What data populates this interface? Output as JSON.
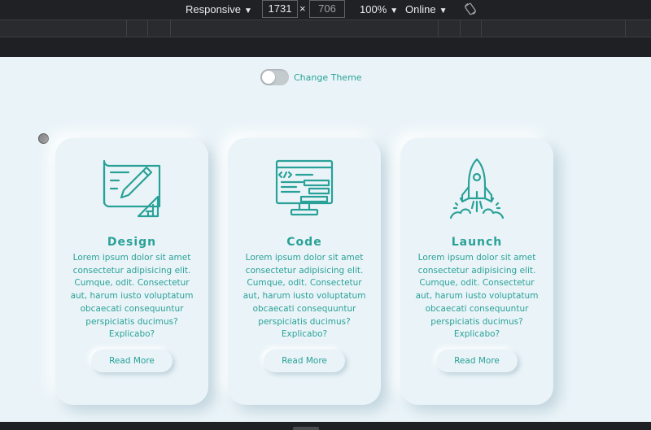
{
  "devtools": {
    "device": "Responsive",
    "width": "1731",
    "height": "706",
    "zoom": "100%",
    "throttle": "Online",
    "icons": {
      "caret": "caret-down-icon",
      "rotate": "rotate-icon"
    }
  },
  "theme_toggle": {
    "label": "Change Theme",
    "on": false
  },
  "cards": [
    {
      "icon": "design-drafting-icon",
      "title": "Design",
      "description": "Lorem ipsum dolor sit amet consectetur adipisicing elit. Cumque, odit. Consectetur aut, harum iusto voluptatum obcaecati consequuntur perspiciatis ducimus? Explicabo?",
      "button": "Read More"
    },
    {
      "icon": "code-monitor-icon",
      "title": "Code",
      "description": "Lorem ipsum dolor sit amet consectetur adipisicing elit. Cumque, odit. Consectetur aut, harum iusto voluptatum obcaecati consequuntur perspiciatis ducimus? Explicabo?",
      "button": "Read More"
    },
    {
      "icon": "rocket-launch-icon",
      "title": "Launch",
      "description": "Lorem ipsum dolor sit amet consectetur adipisicing elit. Cumque, odit. Consectetur aut, harum iusto voluptatum obcaecati consequuntur perspiciatis ducimus? Explicabo?",
      "button": "Read More"
    }
  ],
  "colors": {
    "accent": "#2aa198",
    "background": "#eaf4f8",
    "toolbar": "#202124"
  }
}
